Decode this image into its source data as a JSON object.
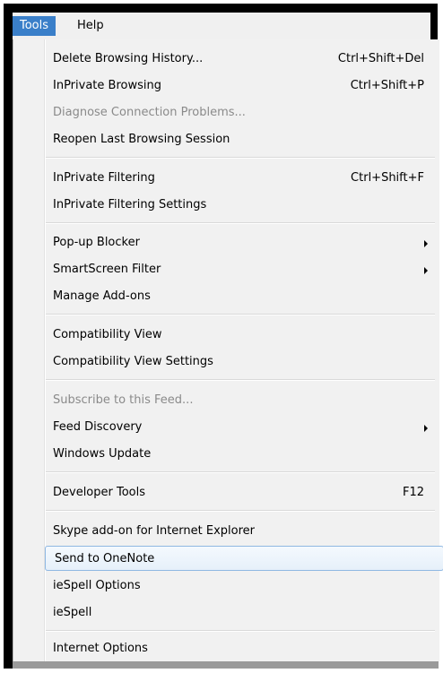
{
  "menubar": {
    "tools_label": "Tools",
    "help_label": "Help"
  },
  "menu": {
    "delete_history": {
      "label": "Delete Browsing History...",
      "shortcut": "Ctrl+Shift+Del"
    },
    "inprivate_browsing": {
      "label": "InPrivate Browsing",
      "shortcut": "Ctrl+Shift+P"
    },
    "diagnose_connection": {
      "label": "Diagnose Connection Problems..."
    },
    "reopen_session": {
      "label": "Reopen Last Browsing Session"
    },
    "inprivate_filtering": {
      "label": "InPrivate Filtering",
      "shortcut": "Ctrl+Shift+F"
    },
    "inprivate_filtering_settings": {
      "label": "InPrivate Filtering Settings"
    },
    "popup_blocker": {
      "label": "Pop-up Blocker"
    },
    "smartscreen_filter": {
      "label": "SmartScreen Filter"
    },
    "manage_addons": {
      "label": "Manage Add-ons"
    },
    "compat_view": {
      "label": "Compatibility View"
    },
    "compat_view_settings": {
      "label": "Compatibility View Settings"
    },
    "subscribe_feed": {
      "label": "Subscribe to this Feed..."
    },
    "feed_discovery": {
      "label": "Feed Discovery"
    },
    "windows_update": {
      "label": "Windows Update"
    },
    "developer_tools": {
      "label": "Developer Tools",
      "shortcut": "F12"
    },
    "skype_addon": {
      "label": "Skype add-on for Internet Explorer"
    },
    "send_onenote": {
      "label": "Send to OneNote"
    },
    "iespell_options": {
      "label": "ieSpell Options"
    },
    "iespell": {
      "label": "ieSpell"
    },
    "internet_options": {
      "label": "Internet Options"
    }
  }
}
